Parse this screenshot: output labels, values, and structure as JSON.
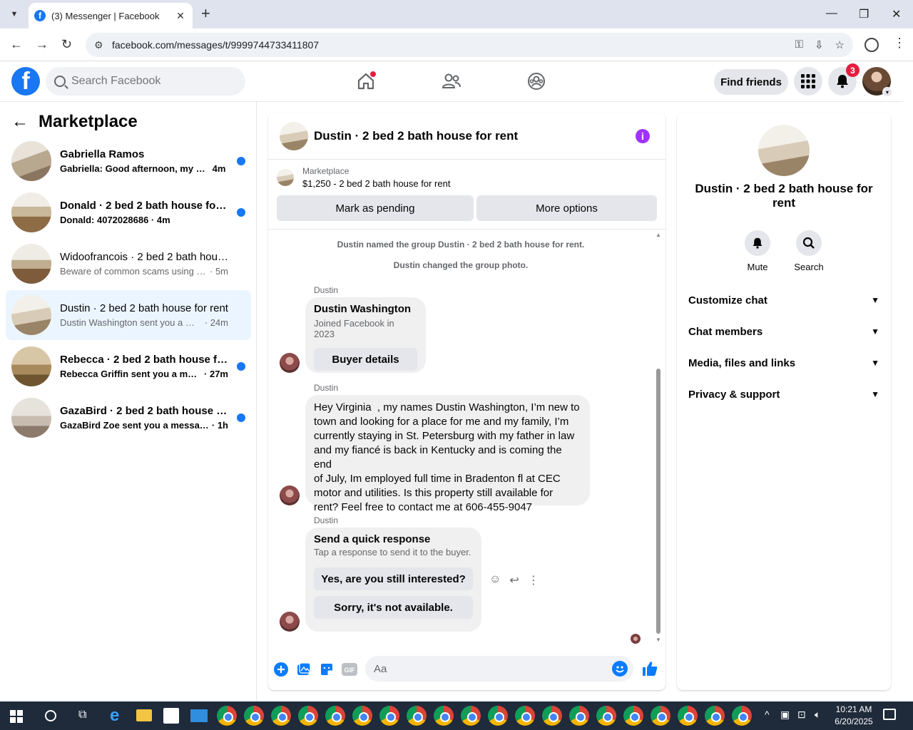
{
  "browser": {
    "tab_title": "(3) Messenger | Facebook",
    "url": "facebook.com/messages/t/9999744733411807"
  },
  "fb": {
    "search_placeholder": "Search Facebook",
    "find_friends": "Find friends",
    "notification_count": "3"
  },
  "left": {
    "title": "Marketplace",
    "conversations": [
      {
        "name": "Gabriella Ramos",
        "preview": "Gabriella: Good afternoon, my na...",
        "time": "4m",
        "unread": true
      },
      {
        "name": "Donald · 2 bed 2 bath house for ...",
        "preview": "Donald: 4072028686",
        "time": "· 4m",
        "unread": true
      },
      {
        "name": "Widoofrancois · 2 bed 2 bath hous...",
        "preview": "Beware of common scams using pay...",
        "time": "· 5m",
        "unread": false
      },
      {
        "name": "Dustin · 2 bed 2 bath house for rent",
        "preview": "Dustin Washington sent you a mess...",
        "time": "· 24m",
        "unread": false,
        "active": true
      },
      {
        "name": "Rebecca · 2 bed 2 bath house for...",
        "preview": "Rebecca Griffin sent you a messa...",
        "time": "· 27m",
        "unread": true
      },
      {
        "name": "GazaBird · 2 bed 2 bath house fo...",
        "preview": "GazaBird Zoe sent you a message ...",
        "time": "· 1h",
        "unread": true
      }
    ]
  },
  "chat": {
    "title": "Dustin · 2 bed 2 bath house for rent",
    "marketplace_label": "Marketplace",
    "listing": "$1,250 - 2 bed 2 bath house for rent",
    "mark_pending": "Mark as pending",
    "more_options": "More options",
    "system_1": "Dustin named the group Dustin · 2 bed 2 bath house for rent.",
    "system_2": "Dustin changed the group photo.",
    "sender": "Dustin",
    "buyer_card": {
      "name": "Dustin Washington",
      "joined": "Joined Facebook in 2023",
      "button": "Buyer details"
    },
    "message": "Hey Virginia  , my names Dustin Washington, I’m new to\ntown and looking for a place for me and my family, I’m\ncurrently staying in St. Petersburg with my father in law\nand my fiancé is back in Kentucky and is coming the end\nof July, Im employed full time in Bradenton fl at CEC\nmotor and utilities. Is this property still available for\nrent? Feel free to contact me at 606-455-9047",
    "quick_response": {
      "title": "Send a quick response",
      "subtitle": "Tap a response to send it to the buyer.",
      "option_1": "Yes, are you still interested?",
      "option_2": "Sorry, it's not available."
    },
    "composer_placeholder": "Aa"
  },
  "right": {
    "name": "Dustin · 2 bed 2 bath house for rent",
    "mute": "Mute",
    "search": "Search",
    "sections": [
      "Customize chat",
      "Chat members",
      "Media, files and links",
      "Privacy & support"
    ]
  },
  "taskbar": {
    "time": "10:21 AM",
    "date": "6/20/2025"
  },
  "colors": {
    "brand": "#1877f2",
    "active_conv": "#ebf5ff",
    "unread_dot": "#1877f2",
    "info": "#a033ff",
    "badge": "#e41e3f"
  }
}
